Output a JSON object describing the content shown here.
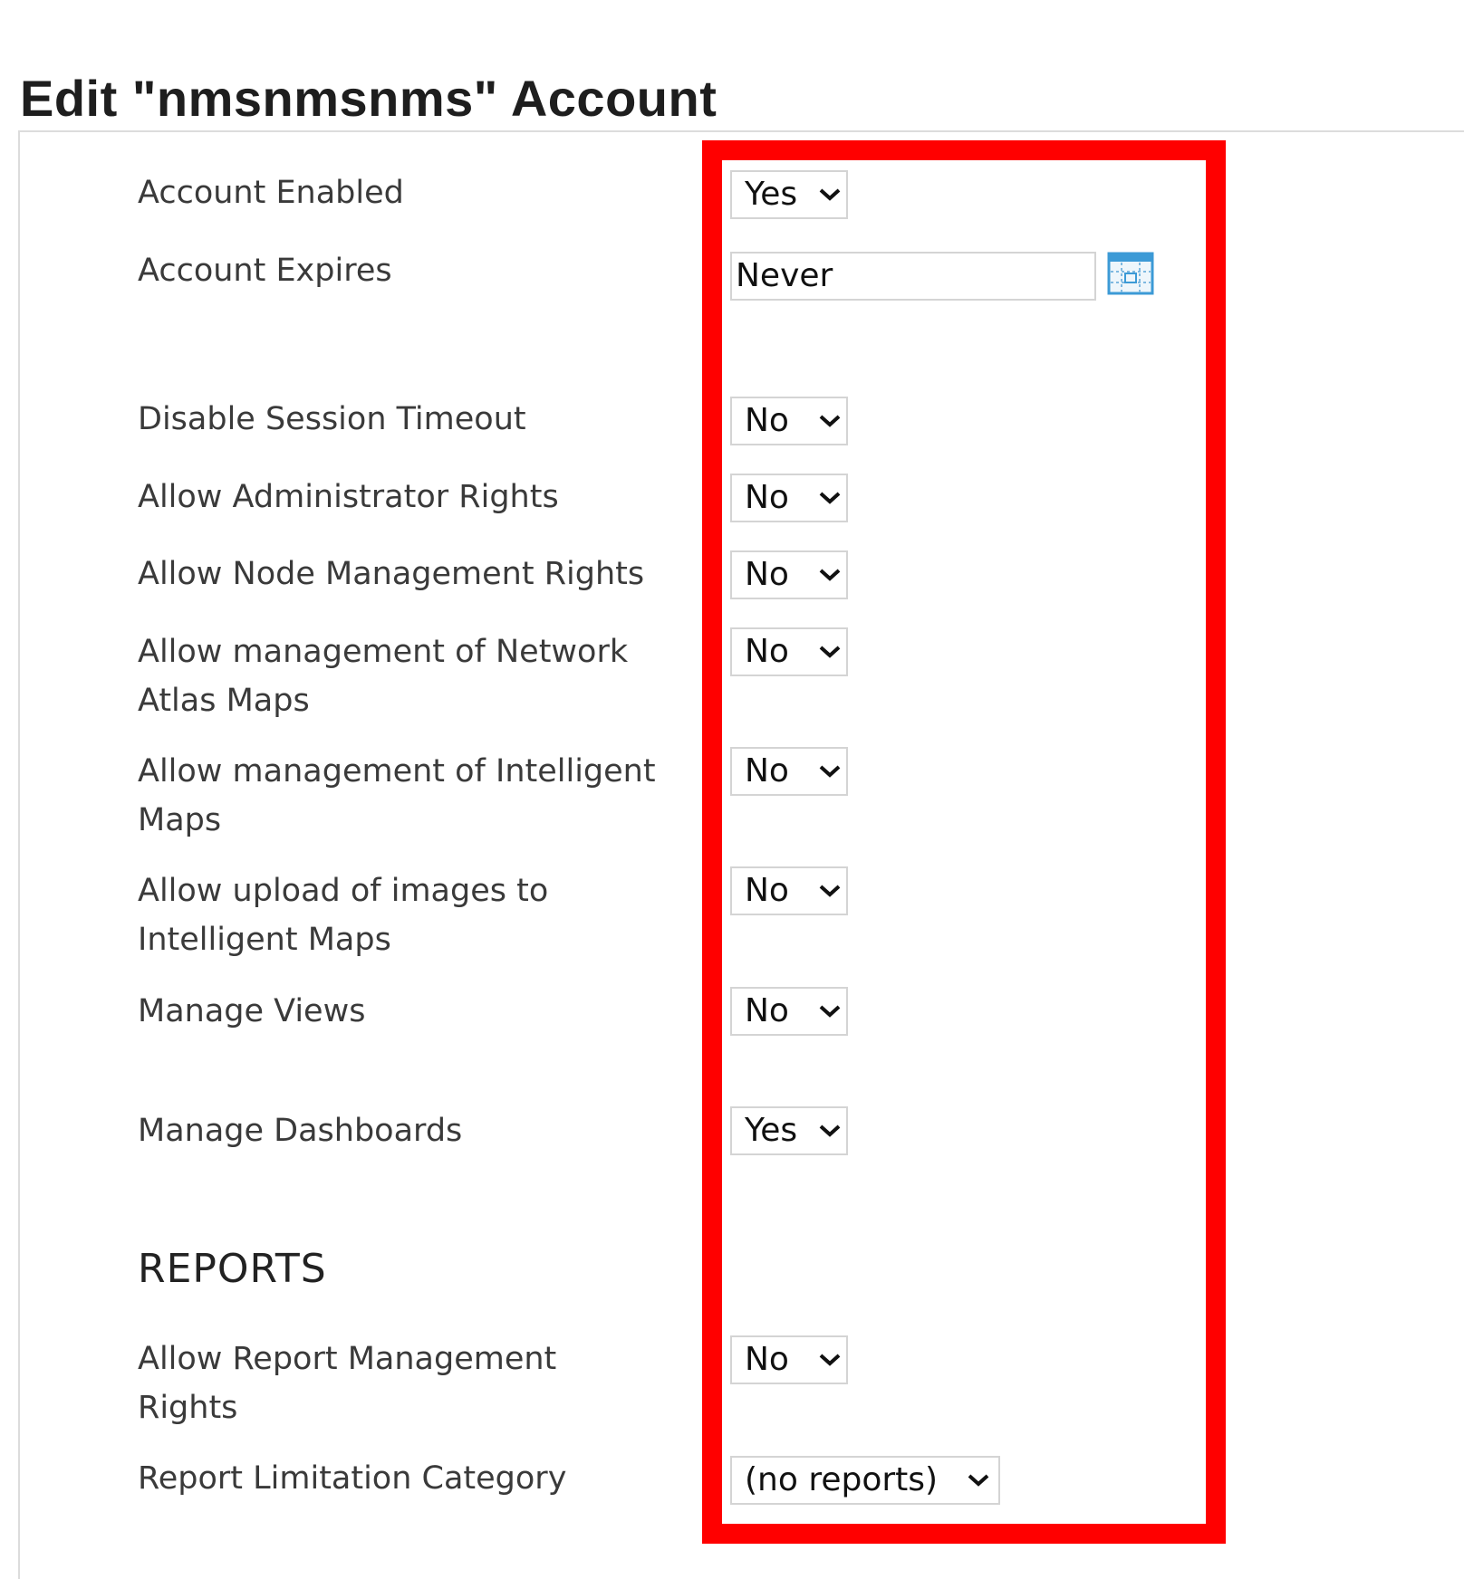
{
  "page_title": "Edit \"nmsnmsnms\" Account",
  "fields": [
    {
      "label": "Account Enabled",
      "value": "Yes"
    },
    {
      "label": "Account Expires",
      "value": "Never"
    },
    {
      "label": "Disable Session Timeout",
      "value": "No"
    },
    {
      "label": "Allow Administrator Rights",
      "value": "No"
    },
    {
      "label": "Allow Node Management Rights",
      "value": "No"
    },
    {
      "label": "Allow management of Network Atlas Maps",
      "value": "No"
    },
    {
      "label": "Allow management of Intelligent Maps",
      "value": "No"
    },
    {
      "label": "Allow upload of images to Intelligent Maps",
      "value": "No"
    },
    {
      "label": "Manage Views",
      "value": "No"
    },
    {
      "label": "Manage Dashboards",
      "value": "Yes"
    }
  ],
  "reports_section": {
    "heading": "REPORTS",
    "fields": [
      {
        "label": "Allow Report Management Rights",
        "value": "No"
      },
      {
        "label": "Report Limitation Category",
        "value": "(no reports)"
      }
    ]
  },
  "icons": {
    "dropdown": "chevron-down-icon",
    "date_picker": "calendar-icon"
  },
  "colors": {
    "highlight": "#ff0000",
    "calendar_icon": "#3c9ad6"
  }
}
